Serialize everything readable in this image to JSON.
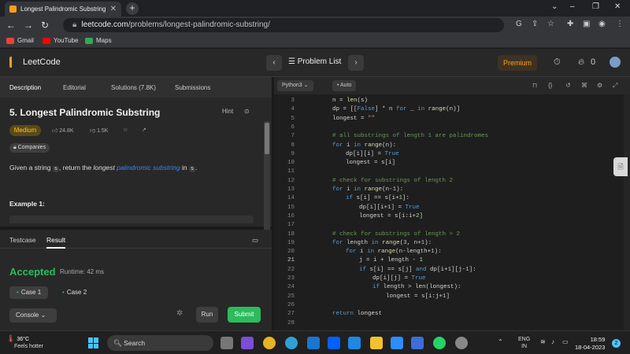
{
  "browser": {
    "tab_title": "Longest Palindromic Substring",
    "url_domain": "leetcode.com",
    "url_path": "/problems/longest-palindromic-substring/",
    "bookmarks": [
      "Gmail",
      "YouTube",
      "Maps"
    ]
  },
  "nav": {
    "logo": "LeetCode",
    "problem_list": "Problem List",
    "premium": "Premium",
    "streak": "0"
  },
  "left_tabs": [
    "Description",
    "Editorial",
    "Solutions (7.8K)",
    "Submissions"
  ],
  "problem": {
    "title": "5. Longest Palindromic Substring",
    "hint": "Hint",
    "difficulty": "Medium",
    "likes": "24.8K",
    "dislikes": "1.5K",
    "companies": "Companies",
    "desc_pre": "Given a string ",
    "desc_code1": "s",
    "desc_mid": ", return the ",
    "desc_italic": "longest ",
    "desc_link": "palindromic substring",
    "desc_in": " in ",
    "desc_code2": "s",
    "desc_end": ".",
    "example_heading": "Example 1:"
  },
  "testcase": {
    "tabs": [
      "Testcase",
      "Result"
    ],
    "status": "Accepted",
    "runtime": "Runtime: 42 ms",
    "cases": [
      "Case 1",
      "Case 2"
    ],
    "console": "Console",
    "run": "Run",
    "submit": "Submit"
  },
  "editor": {
    "language": "Python3",
    "mode": "Auto",
    "lines": [
      {
        "n": "3",
        "indent": 2,
        "t": "n = len(s)"
      },
      {
        "n": "4",
        "indent": 2,
        "t": "dp = [[False] * n for _ in range(n)]"
      },
      {
        "n": "5",
        "indent": 2,
        "t": "longest = \"\""
      },
      {
        "n": "6",
        "indent": 0,
        "t": ""
      },
      {
        "n": "7",
        "indent": 2,
        "t": "# all substrings of length 1 are palindromes"
      },
      {
        "n": "8",
        "indent": 2,
        "t": "for i in range(n):"
      },
      {
        "n": "9",
        "indent": 3,
        "t": "dp[i][i] = True"
      },
      {
        "n": "10",
        "indent": 3,
        "t": "longest = s[i]"
      },
      {
        "n": "11",
        "indent": 0,
        "t": ""
      },
      {
        "n": "12",
        "indent": 2,
        "t": "# check for substrings of length 2"
      },
      {
        "n": "13",
        "indent": 2,
        "t": "for i in range(n-1):"
      },
      {
        "n": "14",
        "indent": 3,
        "t": "if s[i] == s[i+1]:"
      },
      {
        "n": "15",
        "indent": 4,
        "t": "dp[i][i+1] = True"
      },
      {
        "n": "16",
        "indent": 4,
        "t": "longest = s[i:i+2]"
      },
      {
        "n": "17",
        "indent": 0,
        "t": ""
      },
      {
        "n": "18",
        "indent": 2,
        "t": "# check for substrings of length > 2"
      },
      {
        "n": "19",
        "indent": 2,
        "t": "for length in range(3, n+1):"
      },
      {
        "n": "20",
        "indent": 3,
        "t": "for i in range(n-length+1):"
      },
      {
        "n": "21",
        "indent": 4,
        "t": "j = i + length - 1"
      },
      {
        "n": "22",
        "indent": 4,
        "t": "if s[i] == s[j] and dp[i+1][j-1]:"
      },
      {
        "n": "23",
        "indent": 5,
        "t": "dp[i][j] = True"
      },
      {
        "n": "24",
        "indent": 5,
        "t": "if length > len(longest):"
      },
      {
        "n": "25",
        "indent": 6,
        "t": "longest = s[i:j+1]"
      },
      {
        "n": "26",
        "indent": 0,
        "t": ""
      },
      {
        "n": "27",
        "indent": 2,
        "t": "return longest"
      },
      {
        "n": "28",
        "indent": 0,
        "t": ""
      }
    ]
  },
  "taskbar": {
    "temp": "36°C",
    "weather": "Feels hotter",
    "search": "Search",
    "lang1": "ENG",
    "lang2": "IN",
    "time": "18:59",
    "date": "18-04-2023",
    "notifications": "2"
  }
}
